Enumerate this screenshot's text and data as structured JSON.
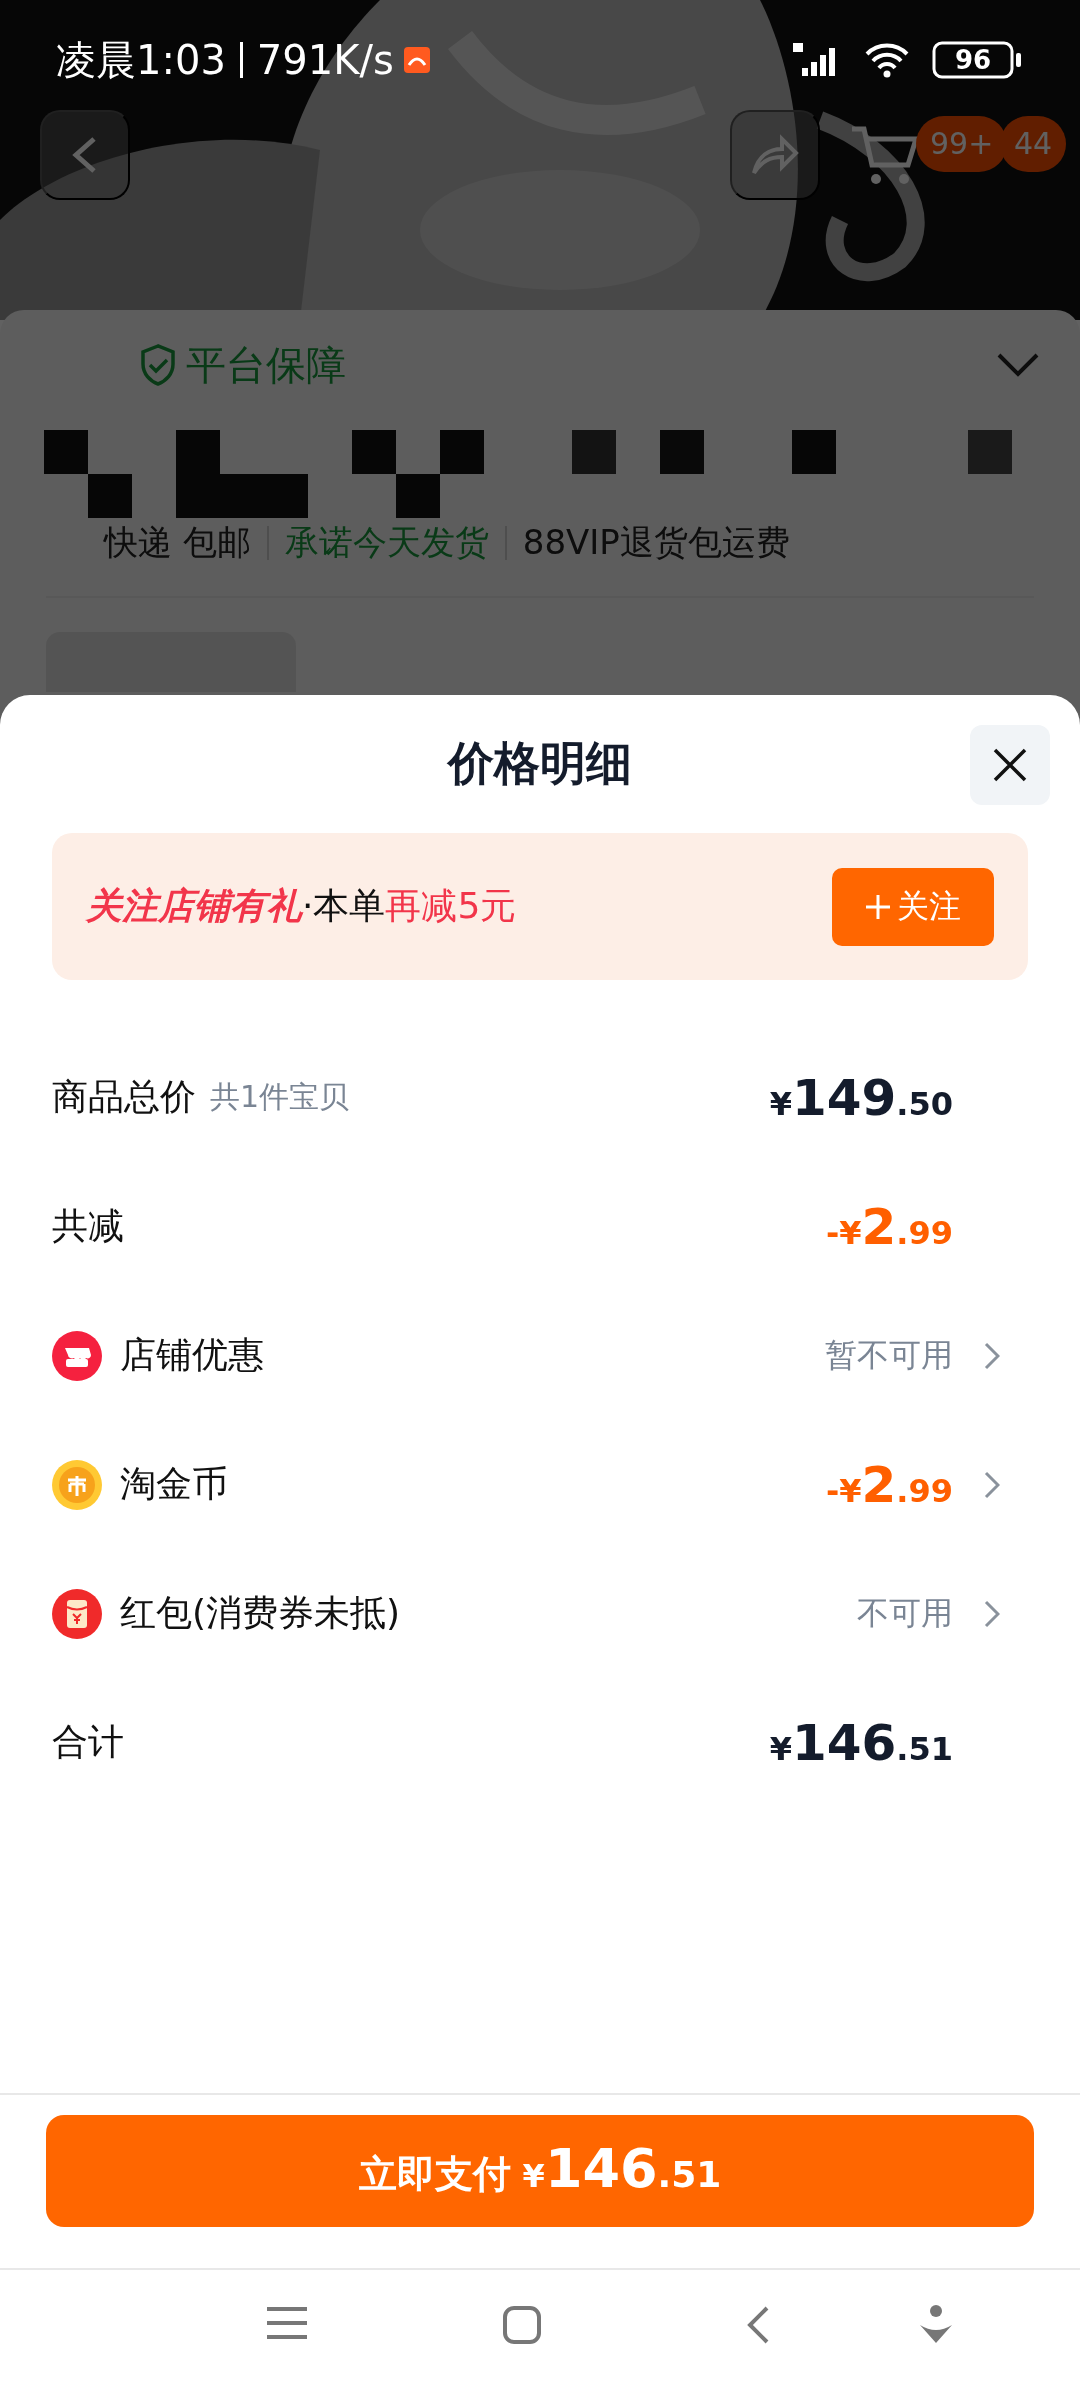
{
  "status_bar": {
    "time": "凌晨1:03",
    "speed": "791K/s",
    "battery": "96"
  },
  "background_page": {
    "cart_badge": "99+",
    "message_badge": "44",
    "guarantee": "平台保障",
    "shipping": [
      {
        "text": "快递 包邮",
        "kind": "plain"
      },
      {
        "text": "承诺今天发货",
        "kind": "promise"
      },
      {
        "text": "88VIP退货包运费",
        "kind": "plain"
      }
    ]
  },
  "sheet": {
    "title": "价格明细",
    "promo": {
      "highlight": "关注店铺有礼",
      "middle": "·本单",
      "offer": "再减5元",
      "button": "关注"
    },
    "rows": [
      {
        "kind": "plain",
        "label": "商品总价",
        "note": "共1件宝贝",
        "discount": false,
        "link": false,
        "amount": {
          "prefix": "¥",
          "main": "149",
          "fraction": ".50"
        }
      },
      {
        "kind": "plain",
        "label": "共减",
        "discount": true,
        "link": false,
        "amount": {
          "prefix": "-¥",
          "main": "2",
          "fraction": ".99"
        }
      },
      {
        "kind": "shop",
        "label": "店铺优惠",
        "link": true,
        "status": "暂不可用"
      },
      {
        "kind": "coin",
        "label": "淘金币",
        "discount": true,
        "link": true,
        "amount": {
          "prefix": "-¥",
          "main": "2",
          "fraction": ".99"
        }
      },
      {
        "kind": "packet",
        "label": "红包(消费券未抵)",
        "link": true,
        "status": "不可用"
      },
      {
        "kind": "plain",
        "label": "合计",
        "discount": false,
        "link": false,
        "amount": {
          "prefix": "¥",
          "main": "146",
          "fraction": ".51"
        }
      }
    ],
    "pay_button": {
      "label": "立即支付",
      "amount": {
        "prefix": "¥",
        "main": "146",
        "fraction": ".51"
      }
    }
  }
}
